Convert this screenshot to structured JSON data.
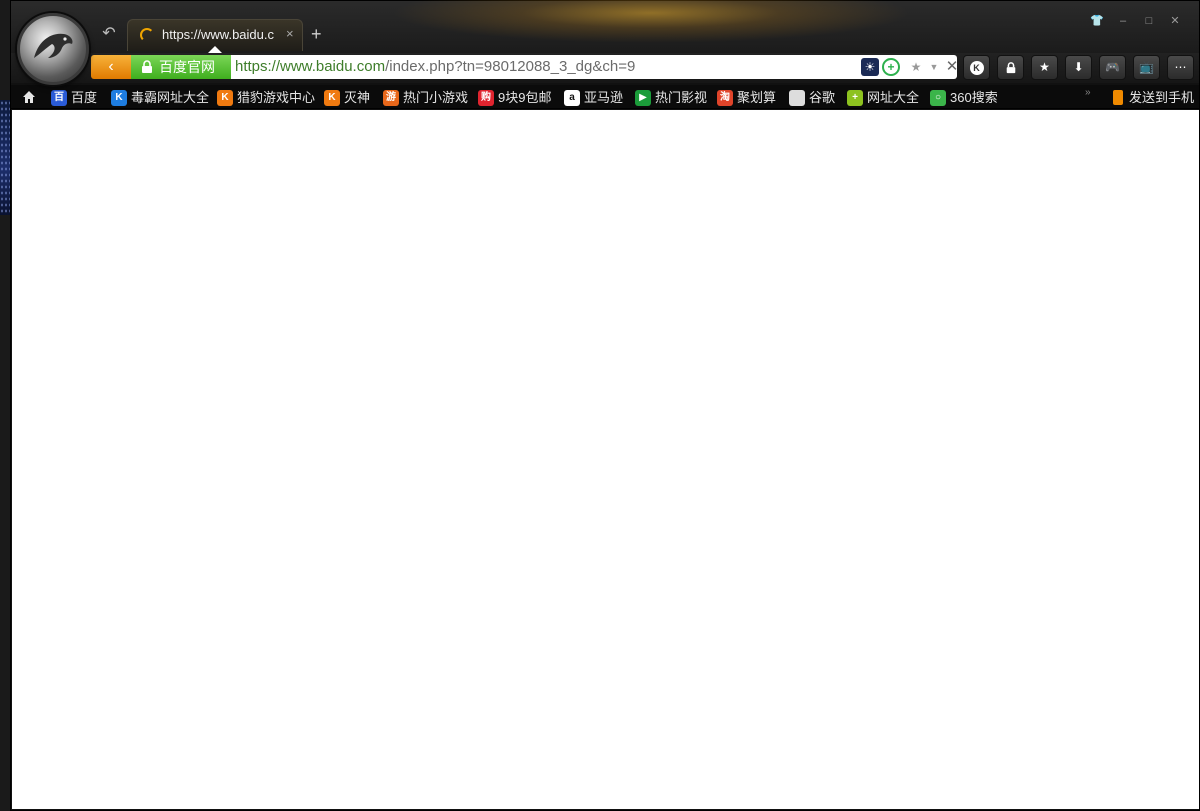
{
  "tab": {
    "title": "https://www.baidu.c",
    "close": "×"
  },
  "new_tab": "+",
  "window_controls": {
    "skin": "👕",
    "minimize": "–",
    "maximize": "□",
    "close": "✕"
  },
  "address": {
    "site_badge": "百度官网",
    "url_host": "https://www.baidu.com",
    "url_rest": "/index.php?tn=98012088_3_dg&ch=9"
  },
  "toolbar_icons": [
    "k-icon",
    "lock-icon",
    "star-icon",
    "download-icon",
    "gamepad-icon",
    "tv-icon",
    "more-icon"
  ],
  "bookmarks": [
    {
      "label": "百度",
      "icon": "baidu-icon",
      "color": "#2a5bd7",
      "glyph": "百"
    },
    {
      "label": "毒霸网址大全",
      "icon": "duba-icon",
      "color": "#1e7de0",
      "glyph": "K"
    },
    {
      "label": "猎豹游戏中心",
      "icon": "liebao-game-icon",
      "color": "#f07a10",
      "glyph": "K"
    },
    {
      "label": "灭神",
      "icon": "mieshen-icon",
      "color": "#f07a10",
      "glyph": "K"
    },
    {
      "label": "热门小游戏",
      "icon": "game-icon",
      "color": "#e8671a",
      "glyph": "游"
    },
    {
      "label": "9块9包邮",
      "icon": "shopping-icon",
      "color": "#e0242f",
      "glyph": "购"
    },
    {
      "label": "亚马逊",
      "icon": "amazon-icon",
      "color": "#ffffff",
      "glyph": "a"
    },
    {
      "label": "热门影视",
      "icon": "video-icon",
      "color": "#1b9c3a",
      "glyph": "▶"
    },
    {
      "label": "聚划算",
      "icon": "juhuasuan-icon",
      "color": "#e0442a",
      "glyph": "淘"
    },
    {
      "label": "谷歌",
      "icon": "document-icon",
      "color": "#dddddd",
      "glyph": ""
    },
    {
      "label": "网址大全",
      "icon": "plus-circle-icon",
      "color": "#8dc21f",
      "glyph": "+"
    },
    {
      "label": "360搜索",
      "icon": "360-search-icon",
      "color": "#3bb44a",
      "glyph": "○"
    }
  ],
  "send_to_phone": "发送到手机"
}
